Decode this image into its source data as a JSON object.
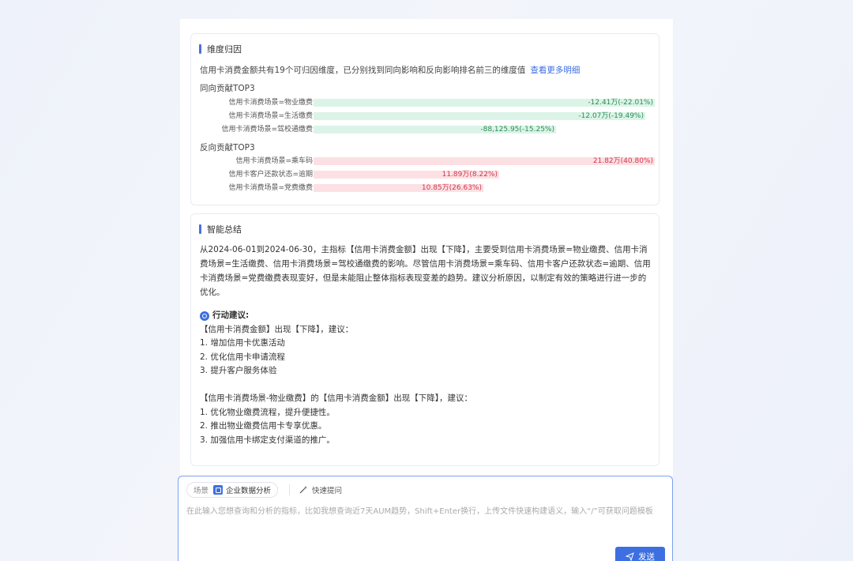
{
  "attribution": {
    "title": "维度归因",
    "description": "信用卡消费金额共有19个可归因维度，已分别找到同向影响和反向影响排名前三的维度值",
    "more_link": "查看更多明细",
    "positive_title": "同向贡献TOP3",
    "negative_title": "反向贡献TOP3",
    "positive": [
      {
        "label": "信用卡消费场景=物业缴费",
        "value": "-12.41万(-22.01%)",
        "amount": 124100
      },
      {
        "label": "信用卡消费场景=生活缴费",
        "value": "-12.07万(-19.49%)",
        "amount": 120700
      },
      {
        "label": "信用卡消费场景=驾校通缴费",
        "value": "-88,125.95(-15.25%)",
        "amount": 88126
      }
    ],
    "negative": [
      {
        "label": "信用卡消费场景=乘车码",
        "value": "21.82万(40.80%)",
        "amount": 218200
      },
      {
        "label": "信用卡客户还款状态=逾期",
        "value": "11.89万(8.22%)",
        "amount": 118900
      },
      {
        "label": "信用卡消费场景=党费缴费",
        "value": "10.85万(26.63%)",
        "amount": 108500
      }
    ],
    "colors": {
      "positive_fill": "#dbf4e7",
      "positive_text": "#2e8b57",
      "negative_fill": "#fde0e3",
      "negative_text": "#d0364a"
    }
  },
  "summary": {
    "title": "智能总结",
    "text": "从2024-06-01到2024-06-30，主指标【信用卡消费金额】出现【下降】，主要受到信用卡消费场景=物业缴费、信用卡消费场景=生活缴费、信用卡消费场景=驾校通缴费的影响。尽管信用卡消费场景=乘车码、信用卡客户还款状态=逾期、信用卡消费场景=党费缴费表现变好，但是未能阻止整体指标表现变差的趋势。建议分析原因，以制定有效的策略进行进一步的优化。",
    "action_title": "行动建议:",
    "block1_intro": "【信用卡消费金额】出现【下降】，建议：",
    "block1_items": [
      "1. 增加信用卡优惠活动",
      "2. 优化信用卡申请流程",
      "3. 提升客户服务体验"
    ],
    "block2_intro": "【信用卡消费场景-物业缴费】的【信用卡消费金额】出现【下降】，建议：",
    "block2_items": [
      "1. 优化物业缴费流程，提升便捷性。",
      "2. 推出物业缴费信用卡专享优惠。",
      "3. 加强信用卡绑定支付渠道的推广。"
    ]
  },
  "input": {
    "scene_label": "场景",
    "scene_value": "企业数据分析",
    "quick_label": "快速提问",
    "placeholder": "在此输入您想查询和分析的指标，比如我想查询近7天AUM趋势，Shift+Enter换行，上传文件快速构建语义，输入“/”可获取问题模板",
    "send_label": "发送",
    "accent_color": "#3d6fe0"
  }
}
